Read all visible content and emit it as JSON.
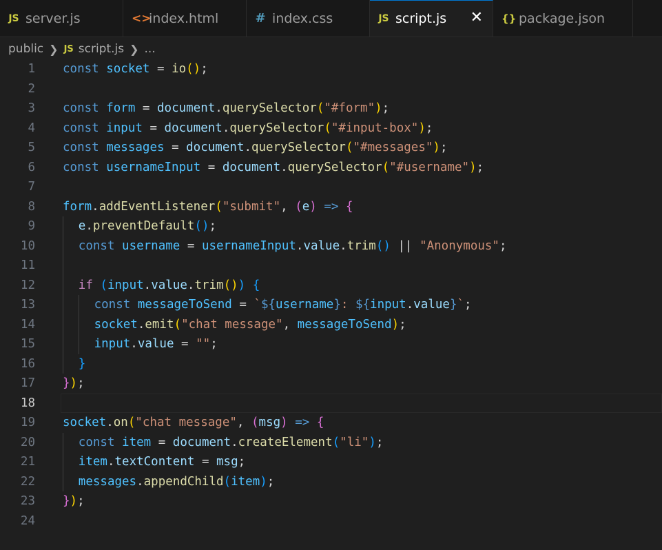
{
  "tabs": [
    {
      "icon": "JS",
      "label": "server.js",
      "active": false
    },
    {
      "icon": "<>",
      "label": "index.html",
      "active": false
    },
    {
      "icon": "#",
      "label": "index.css",
      "active": false
    },
    {
      "icon": "JS",
      "label": "script.js",
      "active": true,
      "close": "✕"
    },
    {
      "icon": "{}",
      "label": "package.json",
      "active": false
    }
  ],
  "breadcrumb": {
    "folder": "public",
    "file_icon": "JS",
    "file": "script.js",
    "rest": "..."
  },
  "editor": {
    "current_line": 18,
    "lines": [
      {
        "n": "1",
        "indent": 0,
        "tokens": [
          [
            "kw",
            "const"
          ],
          [
            "pl",
            " "
          ],
          [
            "cst",
            "socket"
          ],
          [
            "pl",
            " = "
          ],
          [
            "fn",
            "io"
          ],
          [
            "p1",
            "()"
          ],
          [
            "pl",
            ";"
          ]
        ]
      },
      {
        "n": "2",
        "indent": 0,
        "tokens": []
      },
      {
        "n": "3",
        "indent": 0,
        "tokens": [
          [
            "kw",
            "const"
          ],
          [
            "pl",
            " "
          ],
          [
            "cst",
            "form"
          ],
          [
            "pl",
            " = "
          ],
          [
            "var",
            "document"
          ],
          [
            "pl",
            "."
          ],
          [
            "fn",
            "querySelector"
          ],
          [
            "p1",
            "("
          ],
          [
            "str",
            "\"#form\""
          ],
          [
            "p1",
            ")"
          ],
          [
            "pl",
            ";"
          ]
        ]
      },
      {
        "n": "4",
        "indent": 0,
        "tokens": [
          [
            "kw",
            "const"
          ],
          [
            "pl",
            " "
          ],
          [
            "cst",
            "input"
          ],
          [
            "pl",
            " = "
          ],
          [
            "var",
            "document"
          ],
          [
            "pl",
            "."
          ],
          [
            "fn",
            "querySelector"
          ],
          [
            "p1",
            "("
          ],
          [
            "str",
            "\"#input-box\""
          ],
          [
            "p1",
            ")"
          ],
          [
            "pl",
            ";"
          ]
        ]
      },
      {
        "n": "5",
        "indent": 0,
        "tokens": [
          [
            "kw",
            "const"
          ],
          [
            "pl",
            " "
          ],
          [
            "cst",
            "messages"
          ],
          [
            "pl",
            " = "
          ],
          [
            "var",
            "document"
          ],
          [
            "pl",
            "."
          ],
          [
            "fn",
            "querySelector"
          ],
          [
            "p1",
            "("
          ],
          [
            "str",
            "\"#messages\""
          ],
          [
            "p1",
            ")"
          ],
          [
            "pl",
            ";"
          ]
        ]
      },
      {
        "n": "6",
        "indent": 0,
        "tokens": [
          [
            "kw",
            "const"
          ],
          [
            "pl",
            " "
          ],
          [
            "cst",
            "usernameInput"
          ],
          [
            "pl",
            " = "
          ],
          [
            "var",
            "document"
          ],
          [
            "pl",
            "."
          ],
          [
            "fn",
            "querySelector"
          ],
          [
            "p1",
            "("
          ],
          [
            "str",
            "\"#username\""
          ],
          [
            "p1",
            ")"
          ],
          [
            "pl",
            ";"
          ]
        ]
      },
      {
        "n": "7",
        "indent": 0,
        "tokens": []
      },
      {
        "n": "8",
        "indent": 0,
        "tokens": [
          [
            "cst",
            "form"
          ],
          [
            "pl",
            "."
          ],
          [
            "fn",
            "addEventListener"
          ],
          [
            "p1",
            "("
          ],
          [
            "str",
            "\"submit\""
          ],
          [
            "pl",
            ", "
          ],
          [
            "p2",
            "("
          ],
          [
            "var",
            "e"
          ],
          [
            "p2",
            ")"
          ],
          [
            "pl",
            " "
          ],
          [
            "kw",
            "=>"
          ],
          [
            "pl",
            " "
          ],
          [
            "p2",
            "{"
          ]
        ]
      },
      {
        "n": "9",
        "indent": 1,
        "tokens": [
          [
            "var",
            "e"
          ],
          [
            "pl",
            "."
          ],
          [
            "fn",
            "preventDefault"
          ],
          [
            "p3",
            "()"
          ],
          [
            "pl",
            ";"
          ]
        ]
      },
      {
        "n": "10",
        "indent": 1,
        "tokens": [
          [
            "kw",
            "const"
          ],
          [
            "pl",
            " "
          ],
          [
            "cst",
            "username"
          ],
          [
            "pl",
            " = "
          ],
          [
            "cst",
            "usernameInput"
          ],
          [
            "pl",
            "."
          ],
          [
            "var",
            "value"
          ],
          [
            "pl",
            "."
          ],
          [
            "fn",
            "trim"
          ],
          [
            "p3",
            "()"
          ],
          [
            "pl",
            " || "
          ],
          [
            "str",
            "\"Anonymous\""
          ],
          [
            "pl",
            ";"
          ]
        ]
      },
      {
        "n": "11",
        "indent": 1,
        "tokens": []
      },
      {
        "n": "12",
        "indent": 1,
        "tokens": [
          [
            "ctl",
            "if"
          ],
          [
            "pl",
            " "
          ],
          [
            "p3",
            "("
          ],
          [
            "cst",
            "input"
          ],
          [
            "pl",
            "."
          ],
          [
            "var",
            "value"
          ],
          [
            "pl",
            "."
          ],
          [
            "fn",
            "trim"
          ],
          [
            "p1",
            "()"
          ],
          [
            "p3",
            ")"
          ],
          [
            "pl",
            " "
          ],
          [
            "p3",
            "{"
          ]
        ]
      },
      {
        "n": "13",
        "indent": 2,
        "tokens": [
          [
            "kw",
            "const"
          ],
          [
            "pl",
            " "
          ],
          [
            "cst",
            "messageToSend"
          ],
          [
            "pl",
            " = "
          ],
          [
            "str",
            "`"
          ],
          [
            "tpl",
            "${"
          ],
          [
            "cst",
            "username"
          ],
          [
            "tpl",
            "}"
          ],
          [
            "str",
            ": "
          ],
          [
            "tpl",
            "${"
          ],
          [
            "cst",
            "input"
          ],
          [
            "pl",
            "."
          ],
          [
            "var",
            "value"
          ],
          [
            "tpl",
            "}"
          ],
          [
            "str",
            "`"
          ],
          [
            "pl",
            ";"
          ]
        ]
      },
      {
        "n": "14",
        "indent": 2,
        "tokens": [
          [
            "cst",
            "socket"
          ],
          [
            "pl",
            "."
          ],
          [
            "fn",
            "emit"
          ],
          [
            "p1",
            "("
          ],
          [
            "str",
            "\"chat message\""
          ],
          [
            "pl",
            ", "
          ],
          [
            "cst",
            "messageToSend"
          ],
          [
            "p1",
            ")"
          ],
          [
            "pl",
            ";"
          ]
        ]
      },
      {
        "n": "15",
        "indent": 2,
        "tokens": [
          [
            "cst",
            "input"
          ],
          [
            "pl",
            "."
          ],
          [
            "var",
            "value"
          ],
          [
            "pl",
            " = "
          ],
          [
            "str",
            "\"\""
          ],
          [
            "pl",
            ";"
          ]
        ]
      },
      {
        "n": "16",
        "indent": 1,
        "tokens": [
          [
            "p3",
            "}"
          ]
        ]
      },
      {
        "n": "17",
        "indent": 0,
        "tokens": [
          [
            "p2",
            "}"
          ],
          [
            "p1",
            ")"
          ],
          [
            "pl",
            ";"
          ]
        ]
      },
      {
        "n": "18",
        "indent": 0,
        "tokens": []
      },
      {
        "n": "19",
        "indent": 0,
        "tokens": [
          [
            "cst",
            "socket"
          ],
          [
            "pl",
            "."
          ],
          [
            "fn",
            "on"
          ],
          [
            "p1",
            "("
          ],
          [
            "str",
            "\"chat message\""
          ],
          [
            "pl",
            ", "
          ],
          [
            "p2",
            "("
          ],
          [
            "var",
            "msg"
          ],
          [
            "p2",
            ")"
          ],
          [
            "pl",
            " "
          ],
          [
            "kw",
            "=>"
          ],
          [
            "pl",
            " "
          ],
          [
            "p2",
            "{"
          ]
        ]
      },
      {
        "n": "20",
        "indent": 1,
        "tokens": [
          [
            "kw",
            "const"
          ],
          [
            "pl",
            " "
          ],
          [
            "cst",
            "item"
          ],
          [
            "pl",
            " = "
          ],
          [
            "var",
            "document"
          ],
          [
            "pl",
            "."
          ],
          [
            "fn",
            "createElement"
          ],
          [
            "p3",
            "("
          ],
          [
            "str",
            "\"li\""
          ],
          [
            "p3",
            ")"
          ],
          [
            "pl",
            ";"
          ]
        ]
      },
      {
        "n": "21",
        "indent": 1,
        "tokens": [
          [
            "cst",
            "item"
          ],
          [
            "pl",
            "."
          ],
          [
            "var",
            "textContent"
          ],
          [
            "pl",
            " = "
          ],
          [
            "var",
            "msg"
          ],
          [
            "pl",
            ";"
          ]
        ]
      },
      {
        "n": "22",
        "indent": 1,
        "tokens": [
          [
            "cst",
            "messages"
          ],
          [
            "pl",
            "."
          ],
          [
            "fn",
            "appendChild"
          ],
          [
            "p3",
            "("
          ],
          [
            "cst",
            "item"
          ],
          [
            "p3",
            ")"
          ],
          [
            "pl",
            ";"
          ]
        ]
      },
      {
        "n": "23",
        "indent": 0,
        "tokens": [
          [
            "p2",
            "}"
          ],
          [
            "p1",
            ")"
          ],
          [
            "pl",
            ";"
          ]
        ]
      },
      {
        "n": "24",
        "indent": 0,
        "tokens": []
      }
    ]
  },
  "colors": {
    "background": "#1f1f1f",
    "tabbar": "#181818",
    "keyword": "#569cd6",
    "string": "#ce9178",
    "function": "#dcdcaa",
    "constant": "#4fc1ff",
    "variable": "#9cdcfe",
    "control": "#c586c0"
  }
}
